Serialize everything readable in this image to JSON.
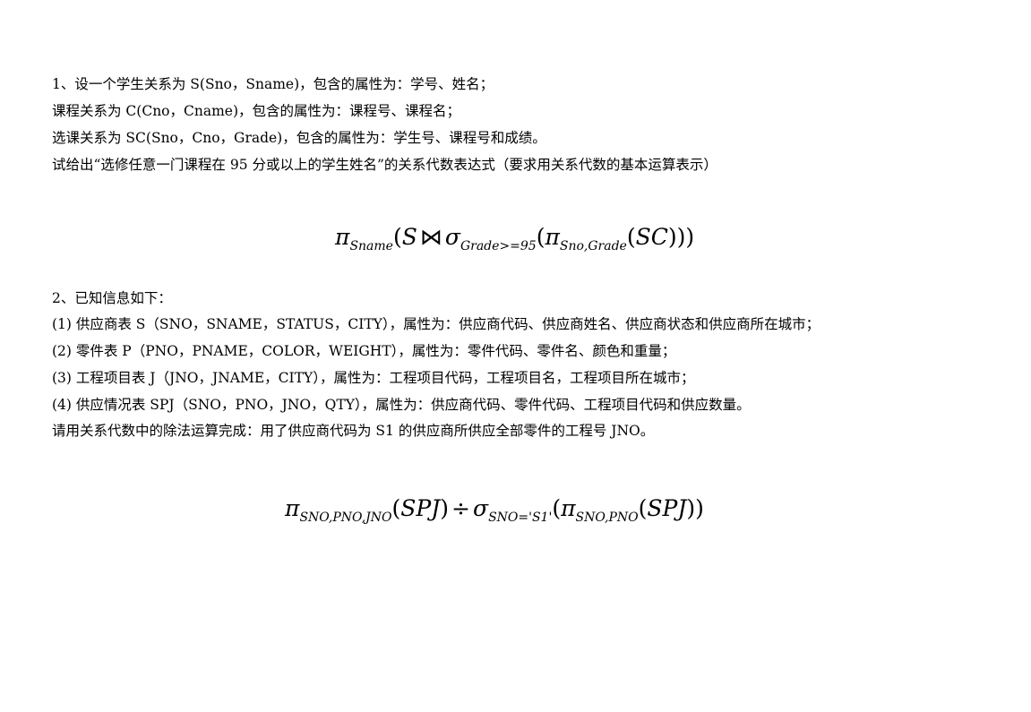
{
  "q1": {
    "lines": [
      "1、设一个学生关系为 S(Sno，Sname)，包含的属性为：学号、姓名；",
      "课程关系为 C(Cno，Cname)，包含的属性为：课程号、课程名；",
      "选课关系为 SC(Sno，Cno，Grade)，包含的属性为：学生号、课程号和成绩。",
      "试给出“选修任意一门课程在 95 分或以上的学生姓名”的关系代数表达式（要求用关系代数的基本运算表示）"
    ],
    "formula": {
      "pi": "π",
      "pi_sub": "Sname",
      "open1": "(",
      "rel_s": "S",
      "join": "⋈",
      "sigma": "σ",
      "sigma_sub": "Grade>=95",
      "open2": "(",
      "pi2": "π",
      "pi2_sub": "Sno,Grade",
      "open3": "(",
      "rel_sc": "SC",
      "close": ")))"
    }
  },
  "q2": {
    "lines": [
      "2、已知信息如下：",
      "(1) 供应商表 S（SNO，SNAME，STATUS，CITY），属性为：供应商代码、供应商姓名、供应商状态和供应商所在城市；",
      "(2) 零件表 P（PNO，PNAME，COLOR，WEIGHT），属性为：零件代码、零件名、颜色和重量；",
      "(3) 工程项目表 J（JNO，JNAME，CITY），属性为：工程项目代码，工程项目名，工程项目所在城市；",
      "(4) 供应情况表 SPJ（SNO，PNO，JNO，QTY），属性为：供应商代码、零件代码、工程项目代码和供应数量。",
      "请用关系代数中的除法运算完成：用了供应商代码为 S1 的供应商所供应全部零件的工程号 JNO。"
    ],
    "formula": {
      "pi": "π",
      "pi_sub": "SNO,PNO,JNO",
      "open1": "(",
      "rel1": "SPJ",
      "close1": ")",
      "div": "÷",
      "sigma": "σ",
      "sigma_sub": "SNO='S1'",
      "open2": "(",
      "pi2": "π",
      "pi2_sub": "SNO,PNO",
      "open3": "(",
      "rel2": "SPJ",
      "close": "))"
    }
  }
}
